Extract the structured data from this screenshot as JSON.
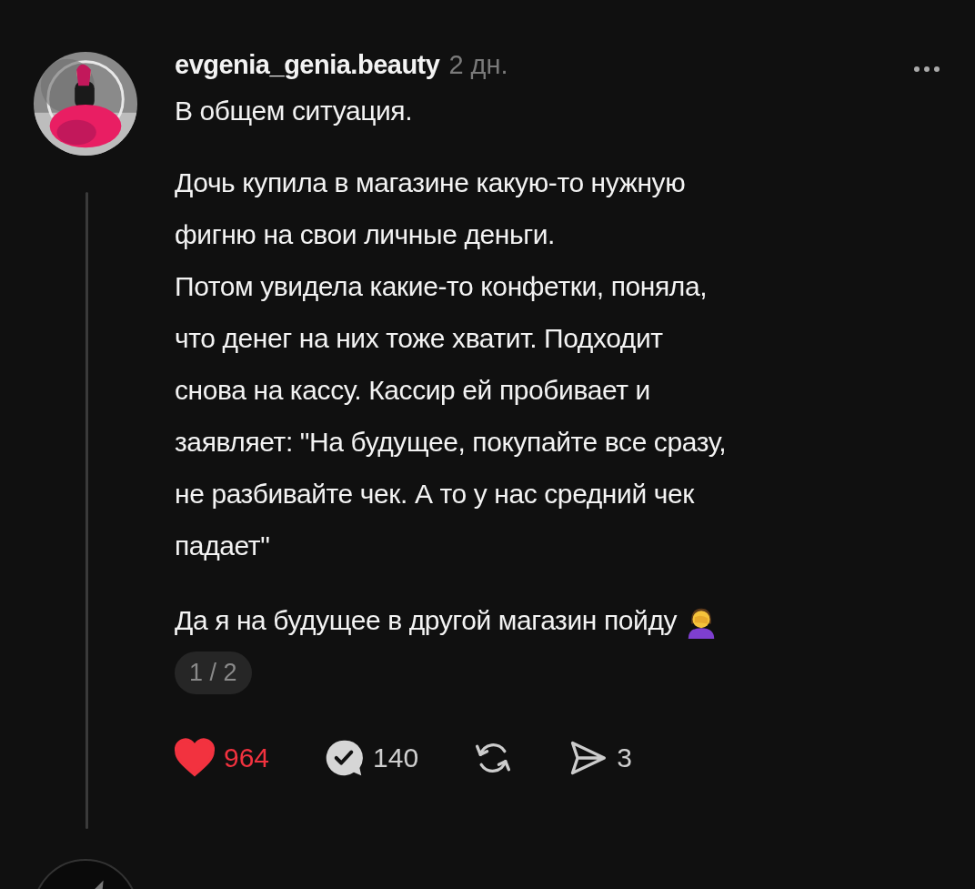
{
  "post": {
    "username": "evgenia_genia.beauty",
    "time": "2 дн.",
    "paragraphs": [
      {
        "kind": "text",
        "lines": [
          "В общем ситуация."
        ]
      },
      {
        "kind": "text",
        "lines": [
          "Дочь купила в магазине какую-то нужную",
          "фигню на свои личные деньги.",
          "Потом увидела какие-то конфетки, поняла,",
          "что денег на них тоже хватит. Подходит",
          "снова на кассу. Кассир ей пробивает и",
          "заявляет: \"На будущее, покупайте все сразу,",
          "не разбивайте чек. А то у нас средний чек",
          "падает\""
        ]
      },
      {
        "lines": [
          "Да я на будущее в другой магазин пойду"
        ],
        "kind": "text_with_emoji"
      }
    ],
    "page_indicator": "1 / 2",
    "actions": [
      {
        "kind": "like",
        "count": "964",
        "selected": true
      },
      {
        "kind": "reply",
        "count": "140"
      },
      {
        "kind": "repost"
      },
      {
        "kind": "share",
        "count": "3"
      }
    ]
  }
}
